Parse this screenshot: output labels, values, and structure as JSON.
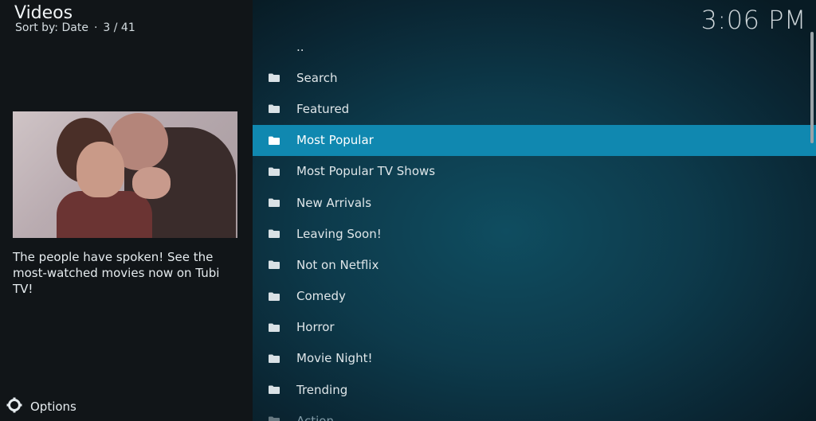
{
  "window": {
    "title": "Videos",
    "sort_label": "Sort by: Date",
    "position": "3 / 41"
  },
  "clock": "3:06 PM",
  "info_panel": {
    "plot": "The people have spoken! See the most-watched movies now on Tubi TV!"
  },
  "footer": {
    "options_label": "Options",
    "icon": "gear-icon"
  },
  "list": {
    "selected_index": 3,
    "items": [
      {
        "label": "..",
        "icon": "none"
      },
      {
        "label": "Search",
        "icon": "folder-icon"
      },
      {
        "label": "Featured",
        "icon": "folder-icon"
      },
      {
        "label": "Most Popular",
        "icon": "folder-icon"
      },
      {
        "label": "Most Popular TV Shows",
        "icon": "folder-icon"
      },
      {
        "label": "New Arrivals",
        "icon": "folder-icon"
      },
      {
        "label": "Leaving Soon!",
        "icon": "folder-icon"
      },
      {
        "label": "Not on Netflix",
        "icon": "folder-icon"
      },
      {
        "label": "Comedy",
        "icon": "folder-icon"
      },
      {
        "label": "Horror",
        "icon": "folder-icon"
      },
      {
        "label": "Movie Night!",
        "icon": "folder-icon"
      },
      {
        "label": "Trending",
        "icon": "folder-icon"
      },
      {
        "label": "Action",
        "icon": "folder-icon"
      }
    ]
  },
  "colors": {
    "selected_row": "#1088b0",
    "left_panel": "#111518",
    "text": "#e6ecef"
  }
}
